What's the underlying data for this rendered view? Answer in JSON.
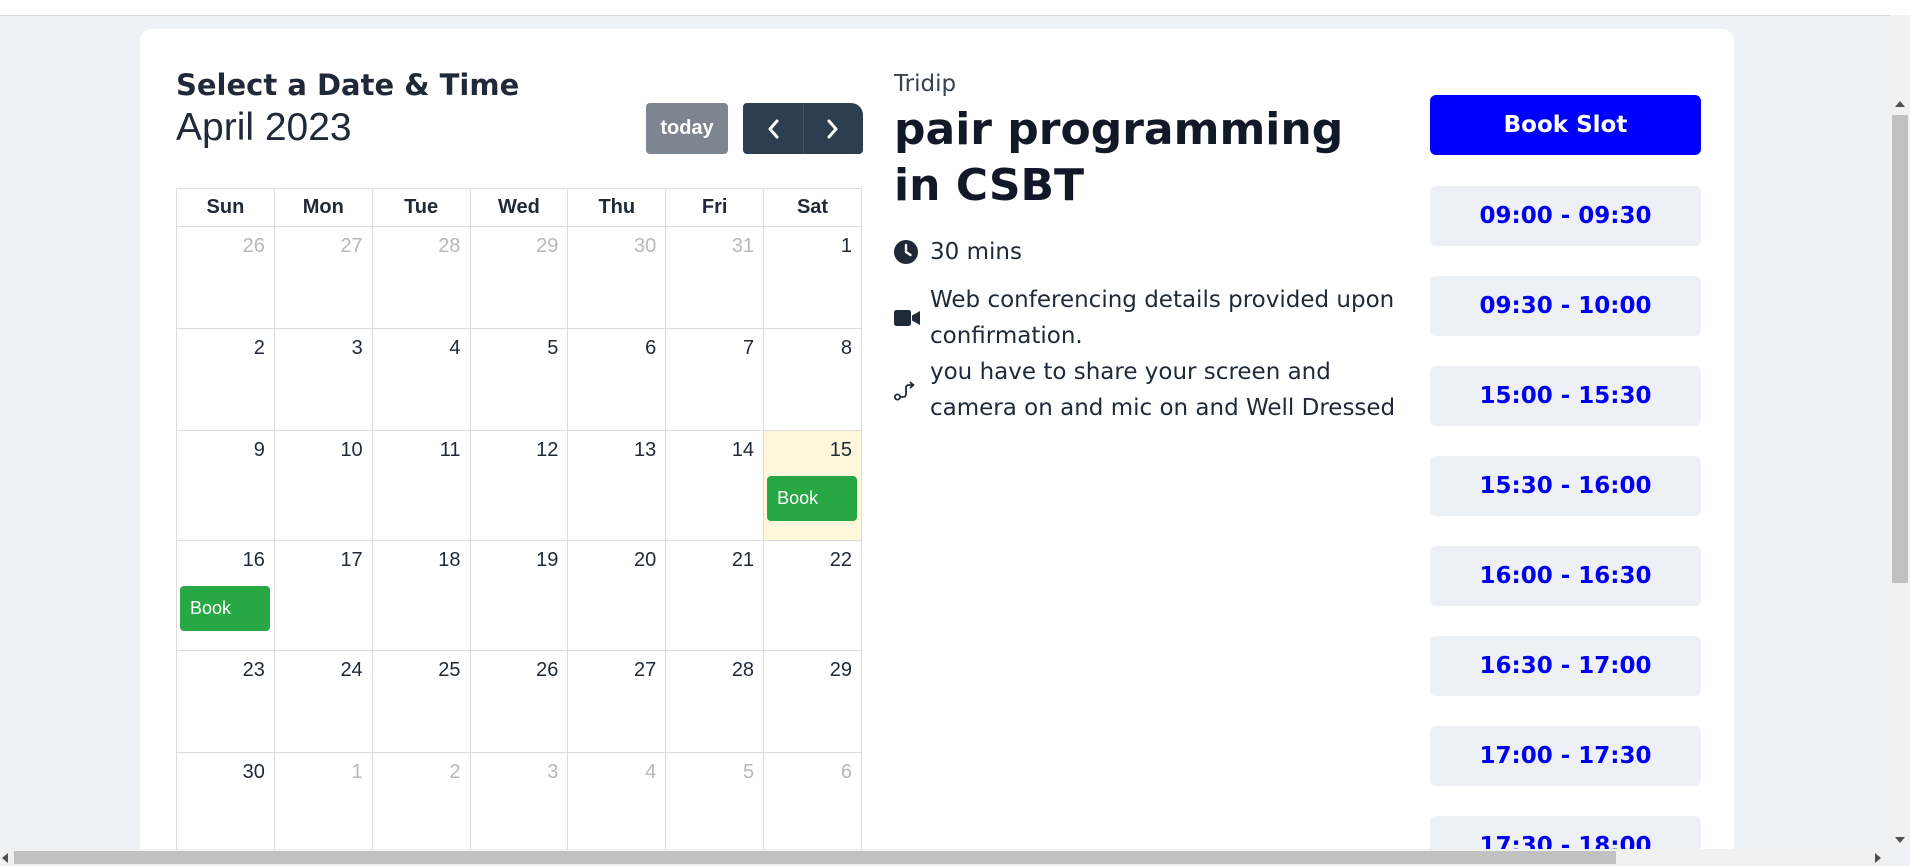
{
  "calendar": {
    "heading": "Select a Date & Time",
    "month_title": "April 2023",
    "today_label": "today",
    "weekdays": [
      "Sun",
      "Mon",
      "Tue",
      "Wed",
      "Thu",
      "Fri",
      "Sat"
    ],
    "weeks": [
      [
        {
          "d": "26",
          "other": true
        },
        {
          "d": "27",
          "other": true
        },
        {
          "d": "28",
          "other": true
        },
        {
          "d": "29",
          "other": true
        },
        {
          "d": "30",
          "other": true
        },
        {
          "d": "31",
          "other": true
        },
        {
          "d": "1"
        }
      ],
      [
        {
          "d": "2"
        },
        {
          "d": "3"
        },
        {
          "d": "4"
        },
        {
          "d": "5"
        },
        {
          "d": "6"
        },
        {
          "d": "7"
        },
        {
          "d": "8"
        }
      ],
      [
        {
          "d": "9"
        },
        {
          "d": "10"
        },
        {
          "d": "11"
        },
        {
          "d": "12"
        },
        {
          "d": "13"
        },
        {
          "d": "14"
        },
        {
          "d": "15",
          "today": true,
          "book": "Book"
        }
      ],
      [
        {
          "d": "16",
          "book": "Book"
        },
        {
          "d": "17"
        },
        {
          "d": "18"
        },
        {
          "d": "19"
        },
        {
          "d": "20"
        },
        {
          "d": "21"
        },
        {
          "d": "22"
        }
      ],
      [
        {
          "d": "23"
        },
        {
          "d": "24"
        },
        {
          "d": "25"
        },
        {
          "d": "26"
        },
        {
          "d": "27"
        },
        {
          "d": "28"
        },
        {
          "d": "29"
        }
      ],
      [
        {
          "d": "30"
        },
        {
          "d": "1",
          "other": true
        },
        {
          "d": "2",
          "other": true
        },
        {
          "d": "3",
          "other": true
        },
        {
          "d": "4",
          "other": true
        },
        {
          "d": "5",
          "other": true
        },
        {
          "d": "6",
          "other": true
        }
      ]
    ]
  },
  "event": {
    "host": "Tridip",
    "title": "pair programming in CSBT",
    "duration": "30 mins",
    "location": "Web conferencing details provided upon confirmation.",
    "description": "you have to share your screen and camera on and mic on and Well Dressed"
  },
  "slots": {
    "book_label": "Book Slot",
    "times": [
      "09:00 - 09:30",
      "09:30 - 10:00",
      "15:00 - 15:30",
      "15:30 - 16:00",
      "16:00 - 16:30",
      "16:30 - 17:00",
      "17:00 - 17:30",
      "17:30 - 18:00"
    ]
  },
  "colors": {
    "book_slot_bg": "#0000ff",
    "slot_text": "#0000ee",
    "book_event": "#28a745",
    "nav_dark": "#2c3e50",
    "today_highlight": "#fef7dc"
  }
}
